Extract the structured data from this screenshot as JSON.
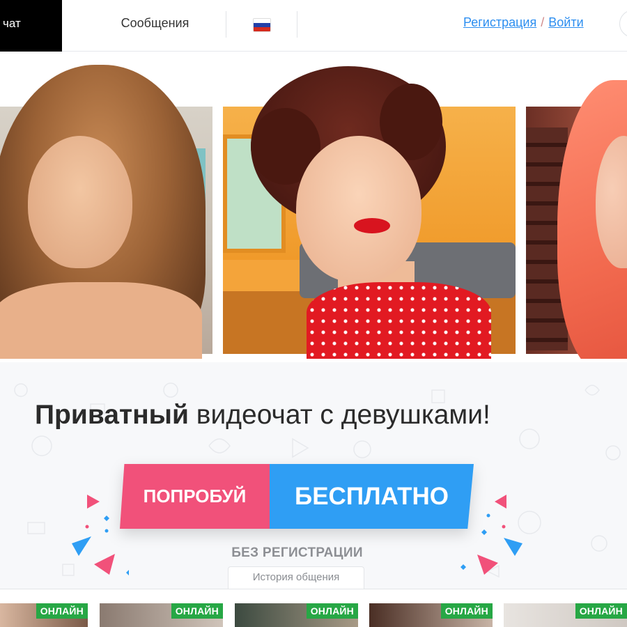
{
  "header": {
    "active_nav_label": "чат",
    "messages_label": "Сообщения",
    "language_flag": "ru-flag-icon",
    "register_label": "Регистрация",
    "separator": "/",
    "login_label": "Войти"
  },
  "hero": {
    "photos": [
      "model-photo",
      "model-photo",
      "model-photo"
    ]
  },
  "promo": {
    "headline_bold": "Приватный",
    "headline_rest": " видеочат с девушками!",
    "cta_left": "ПОПРОБУЙ",
    "cta_right": "БЕСПЛАТНО",
    "subcaption": "БЕЗ РЕГИСТРАЦИИ",
    "history_tab": "История общения"
  },
  "thumbnails": {
    "badge_label": "ОНЛАЙН",
    "items": [
      {
        "badge": "ОНЛАЙН"
      },
      {
        "badge": "ОНЛАЙН"
      },
      {
        "badge": "ОНЛАЙН"
      },
      {
        "badge": "ОНЛАЙН"
      },
      {
        "badge": "ОНЛАЙН"
      }
    ]
  },
  "colors": {
    "cta_pink": "#f1517a",
    "cta_blue": "#2f9ef4",
    "link_blue": "#2c8ef0",
    "online_green": "#27a745"
  }
}
